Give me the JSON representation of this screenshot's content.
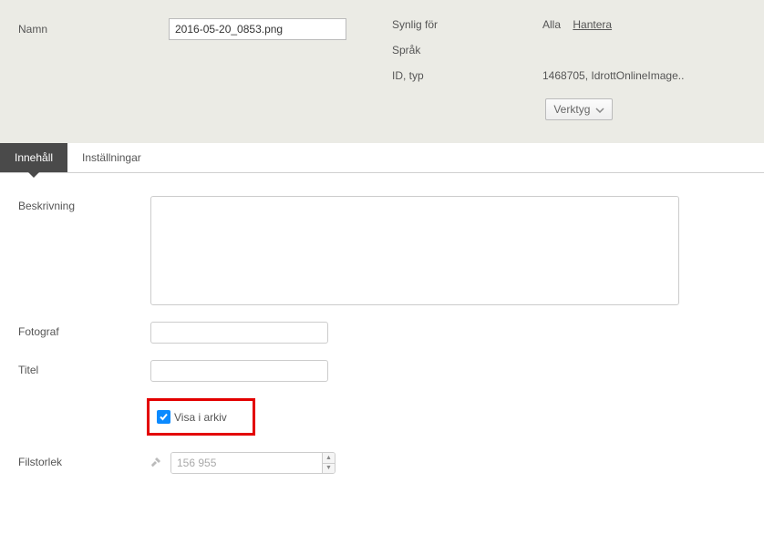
{
  "header": {
    "name_label": "Namn",
    "name_value": "2016-05-20_0853.png",
    "visible_for_label": "Synlig för",
    "visible_for_value": "Alla",
    "manage_link": "Hantera",
    "language_label": "Språk",
    "id_type_label": "ID, typ",
    "id_type_value": "1468705, IdrottOnlineImage..",
    "tools_label": "Verktyg"
  },
  "tabs": {
    "content": "Innehåll",
    "settings": "Inställningar"
  },
  "form": {
    "description_label": "Beskrivning",
    "photographer_label": "Fotograf",
    "title_label": "Titel",
    "show_in_archive_label": "Visa i arkiv",
    "filesize_label": "Filstorlek",
    "filesize_value": "156 955"
  }
}
